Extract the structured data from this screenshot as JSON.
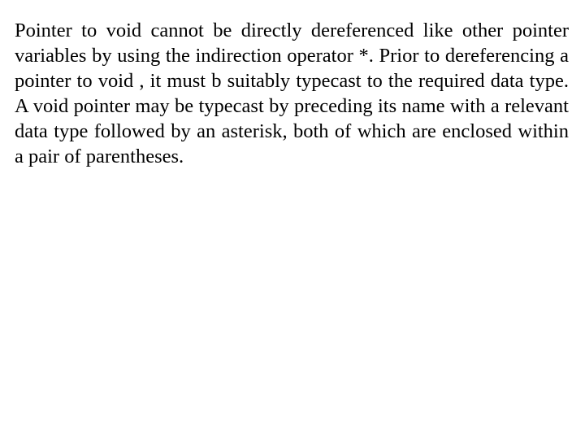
{
  "document": {
    "paragraphs": [
      "Pointer to void cannot be directly dereferenced like other pointer variables by using the indirection operator *. Prior to dereferencing a pointer to void , it must b suitably typecast to the required data type. A void pointer may be typecast by preceding its name with a relevant data type followed by an asterisk, both of which are enclosed within a pair of parentheses."
    ]
  }
}
